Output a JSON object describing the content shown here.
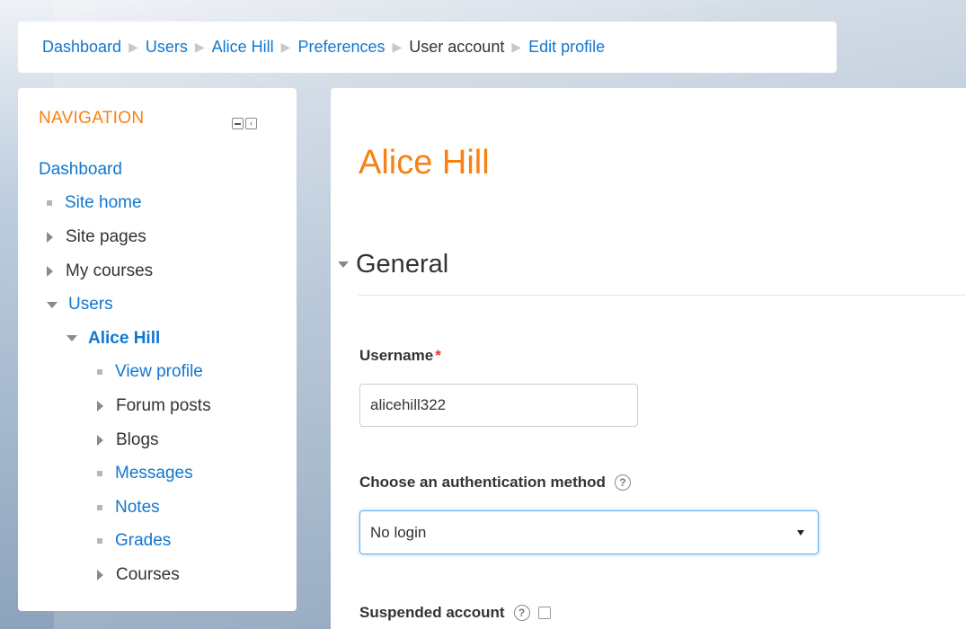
{
  "breadcrumb": {
    "items": [
      {
        "label": "Dashboard"
      },
      {
        "label": "Users"
      },
      {
        "label": "Alice Hill"
      },
      {
        "label": "Preferences"
      },
      {
        "label": "User account"
      },
      {
        "label": "Edit profile"
      }
    ]
  },
  "navigation": {
    "title": "NAVIGATION",
    "items": [
      {
        "label": "Dashboard"
      },
      {
        "label": "Site home"
      },
      {
        "label": "Site pages"
      },
      {
        "label": "My courses"
      },
      {
        "label": "Users"
      },
      {
        "label": "Alice Hill"
      },
      {
        "label": "View profile"
      },
      {
        "label": "Forum posts"
      },
      {
        "label": "Blogs"
      },
      {
        "label": "Messages"
      },
      {
        "label": "Notes"
      },
      {
        "label": "Grades"
      },
      {
        "label": "Courses"
      }
    ]
  },
  "main": {
    "page_title": "Alice Hill",
    "section_title": "General",
    "username_label": "Username",
    "required_mark": "*",
    "username_value": "alicehill322",
    "auth_label": "Choose an authentication method",
    "auth_value": "No login",
    "suspended_label": "Suspended account",
    "help_glyph": "?"
  },
  "colors": {
    "link": "#1177d1",
    "accent": "#f98012"
  }
}
